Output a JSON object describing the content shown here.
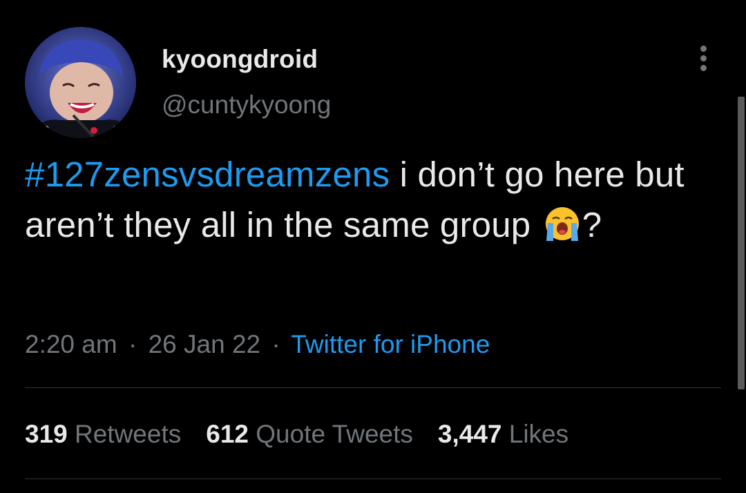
{
  "tweet": {
    "author": {
      "display_name": "kyoongdroid",
      "handle": "@cuntykyoong",
      "avatar_icon": "profile-photo"
    },
    "more_icon": "more-vertical-icon",
    "text": {
      "hashtag": "#127zensvsdreamzens",
      "part1": " i don’t go here but aren’t they all in the same group ",
      "emoji_icon": "loudly-crying-face-emoji",
      "part2": "?"
    },
    "meta": {
      "time": "2:20 am",
      "separator": "·",
      "date": "26 Jan 22",
      "source": "Twitter for iPhone"
    },
    "stats": {
      "retweets_count": "319",
      "retweets_label": " Retweets",
      "quotes_count": "612",
      "quotes_label": " Quote Tweets",
      "likes_count": "3,447",
      "likes_label": " Likes"
    }
  },
  "colors": {
    "background": "#000000",
    "text_primary": "#e7e9ea",
    "text_secondary": "#71767b",
    "link_blue": "#1d9bf0",
    "divider": "#2f3336"
  }
}
